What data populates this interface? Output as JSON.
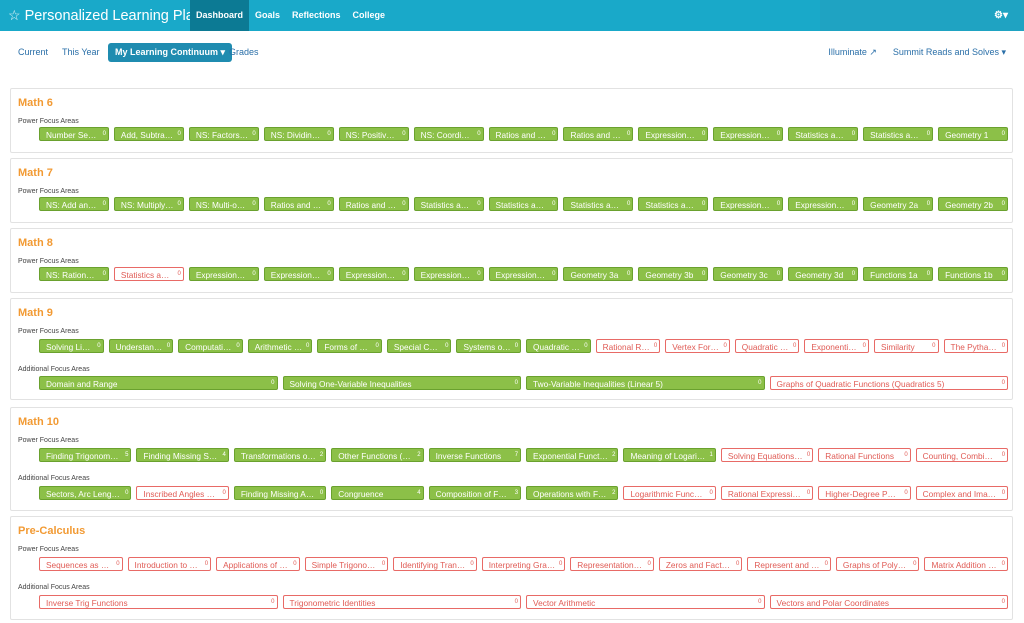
{
  "header": {
    "app_title": "Personalized Learning Plan",
    "nav": [
      "Dashboard",
      "Goals",
      "Reflections",
      "College"
    ],
    "user_icon": "⚙▾"
  },
  "subnav": {
    "tabs": [
      "Current",
      "This Year",
      "My Learning Continuum ▾",
      "Grades"
    ],
    "right_links": [
      "Illuminate ↗",
      "Summit Reads and Solves ▾"
    ]
  },
  "labels": {
    "power": "Power Focus Areas",
    "additional": "Additional Focus Areas"
  },
  "colors": {
    "header": "#19a9c9",
    "complete_green": "#8cc048",
    "incomplete_red": "#e05b55",
    "section_title": "#f29a33"
  },
  "sections": [
    {
      "title": "Math 6",
      "power": [
        {
          "t": "Number Sense",
          "c": "0",
          "s": "g"
        },
        {
          "t": "Add, Subtra…",
          "c": "0",
          "s": "g"
        },
        {
          "t": "NS: Factors …",
          "c": "0",
          "s": "g"
        },
        {
          "t": "NS: Dividing…",
          "c": "0",
          "s": "g"
        },
        {
          "t": "NS: Positive…",
          "c": "0",
          "s": "g"
        },
        {
          "t": "NS: Coordin…",
          "c": "0",
          "s": "g"
        },
        {
          "t": "Ratios and …",
          "c": "0",
          "s": "g"
        },
        {
          "t": "Ratios and …",
          "c": "0",
          "s": "g"
        },
        {
          "t": "Expressions…",
          "c": "0",
          "s": "g"
        },
        {
          "t": "Expressions…",
          "c": "0",
          "s": "g"
        },
        {
          "t": "Statistics an…",
          "c": "0",
          "s": "g"
        },
        {
          "t": "Statistics an…",
          "c": "0",
          "s": "g"
        },
        {
          "t": "Geometry 1",
          "c": "0",
          "s": "g"
        }
      ],
      "additional": []
    },
    {
      "title": "Math 7",
      "power": [
        {
          "t": "NS: Add an…",
          "c": "0",
          "s": "g"
        },
        {
          "t": "NS: Multiply…",
          "c": "0",
          "s": "g"
        },
        {
          "t": "NS: Multi-o…",
          "c": "0",
          "s": "g"
        },
        {
          "t": "Ratios and …",
          "c": "0",
          "s": "g"
        },
        {
          "t": "Ratios and …",
          "c": "0",
          "s": "g"
        },
        {
          "t": "Statistics an…",
          "c": "0",
          "s": "g"
        },
        {
          "t": "Statistics an…",
          "c": "0",
          "s": "g"
        },
        {
          "t": "Statistics an…",
          "c": "0",
          "s": "g"
        },
        {
          "t": "Statistics an…",
          "c": "0",
          "s": "g"
        },
        {
          "t": "Expressions…",
          "c": "0",
          "s": "g"
        },
        {
          "t": "Expressions…",
          "c": "0",
          "s": "g"
        },
        {
          "t": "Geometry 2a",
          "c": "0",
          "s": "g"
        },
        {
          "t": "Geometry 2b",
          "c": "0",
          "s": "g"
        }
      ],
      "additional": []
    },
    {
      "title": "Math 8",
      "power": [
        {
          "t": "NS: Rational…",
          "c": "0",
          "s": "g"
        },
        {
          "t": "Statistics an…",
          "c": "0",
          "s": "r"
        },
        {
          "t": "Expressions…",
          "c": "0",
          "s": "g"
        },
        {
          "t": "Expressions…",
          "c": "0",
          "s": "g"
        },
        {
          "t": "Expressions…",
          "c": "0",
          "s": "g"
        },
        {
          "t": "Expressions…",
          "c": "0",
          "s": "g"
        },
        {
          "t": "Expressions…",
          "c": "0",
          "s": "g"
        },
        {
          "t": "Geometry 3a",
          "c": "0",
          "s": "g"
        },
        {
          "t": "Geometry 3b",
          "c": "0",
          "s": "g"
        },
        {
          "t": "Geometry 3c",
          "c": "0",
          "s": "g"
        },
        {
          "t": "Geometry 3d",
          "c": "0",
          "s": "g"
        },
        {
          "t": "Functions 1a",
          "c": "0",
          "s": "g"
        },
        {
          "t": "Functions 1b",
          "c": "0",
          "s": "g"
        }
      ],
      "additional": []
    },
    {
      "title": "Math 9",
      "power": [
        {
          "t": "Solving Lin…",
          "c": "0",
          "s": "g"
        },
        {
          "t": "Understan…",
          "c": "0",
          "s": "g"
        },
        {
          "t": "Computati…",
          "c": "0",
          "s": "g"
        },
        {
          "t": "Arithmetic …",
          "c": "0",
          "s": "g"
        },
        {
          "t": "Forms of L…",
          "c": "0",
          "s": "g"
        },
        {
          "t": "Special Ca…",
          "c": "0",
          "s": "g"
        },
        {
          "t": "Systems of…",
          "c": "0",
          "s": "g"
        },
        {
          "t": "Quadratic …",
          "c": "0",
          "s": "g"
        },
        {
          "t": "Rational R…",
          "c": "0",
          "s": "r"
        },
        {
          "t": "Vertex For…",
          "c": "0",
          "s": "r"
        },
        {
          "t": "Quadratic …",
          "c": "0",
          "s": "r"
        },
        {
          "t": "Exponenti…",
          "c": "0",
          "s": "r"
        },
        {
          "t": "Similarity",
          "c": "0",
          "s": "r"
        },
        {
          "t": "The Pytha…",
          "c": "0",
          "s": "r"
        }
      ],
      "additional": [
        {
          "t": "Domain and Range",
          "c": "0",
          "s": "g"
        },
        {
          "t": "Solving One-Variable Inequalities",
          "c": "0",
          "s": "g"
        },
        {
          "t": "Two-Variable Inequalities (Linear 5)",
          "c": "0",
          "s": "g"
        },
        {
          "t": "Graphs of Quadratic Functions (Quadratics 5)",
          "c": "0",
          "s": "r"
        }
      ]
    },
    {
      "title": "Math 10",
      "power": [
        {
          "t": "Finding Trigonom…",
          "c": "5",
          "s": "g"
        },
        {
          "t": "Finding Missing Si…",
          "c": "4",
          "s": "g"
        },
        {
          "t": "Transformations o…",
          "c": "2",
          "s": "g"
        },
        {
          "t": "Other Functions (…",
          "c": "2",
          "s": "g"
        },
        {
          "t": "Inverse Functions",
          "c": "7",
          "s": "g"
        },
        {
          "t": "Exponential Funct…",
          "c": "2",
          "s": "g"
        },
        {
          "t": "Meaning of Logari…",
          "c": "1",
          "s": "g"
        },
        {
          "t": "Solving Equations…",
          "c": "0",
          "s": "r"
        },
        {
          "t": "Rational Functions",
          "c": "0",
          "s": "r"
        },
        {
          "t": "Counting, Combi…",
          "c": "0",
          "s": "r"
        }
      ],
      "additional": [
        {
          "t": "Sectors, Arc Leng…",
          "c": "0",
          "s": "g"
        },
        {
          "t": "Inscribed Angles …",
          "c": "0",
          "s": "r"
        },
        {
          "t": "Finding Missing A…",
          "c": "0",
          "s": "g"
        },
        {
          "t": "Congruence",
          "c": "4",
          "s": "g"
        },
        {
          "t": "Composition of F…",
          "c": "3",
          "s": "g"
        },
        {
          "t": "Operations with F…",
          "c": "2",
          "s": "g"
        },
        {
          "t": "Logarithmic Func…",
          "c": "0",
          "s": "r"
        },
        {
          "t": "Rational Expressi…",
          "c": "0",
          "s": "r"
        },
        {
          "t": "Higher-Degree P…",
          "c": "0",
          "s": "r"
        },
        {
          "t": "Complex and Ima…",
          "c": "0",
          "s": "r"
        }
      ]
    },
    {
      "title": "Pre-Calculus",
      "power": [
        {
          "t": "Sequences as …",
          "c": "0",
          "s": "r"
        },
        {
          "t": "Introduction to …",
          "c": "0",
          "s": "r"
        },
        {
          "t": "Applications of …",
          "c": "0",
          "s": "r"
        },
        {
          "t": "Simple Trigono…",
          "c": "0",
          "s": "r"
        },
        {
          "t": "Identifying Tran…",
          "c": "0",
          "s": "r"
        },
        {
          "t": "Interpreting Gra…",
          "c": "0",
          "s": "r"
        },
        {
          "t": "Representation …",
          "c": "0",
          "s": "r"
        },
        {
          "t": "Zeros and Fact…",
          "c": "0",
          "s": "r"
        },
        {
          "t": "Represent and …",
          "c": "0",
          "s": "r"
        },
        {
          "t": "Graphs of Poly…",
          "c": "0",
          "s": "r"
        },
        {
          "t": "Matrix Addition …",
          "c": "0",
          "s": "r"
        }
      ],
      "additional": [
        {
          "t": "Inverse Trig Functions",
          "c": "0",
          "s": "r"
        },
        {
          "t": "Trigonometric Identities",
          "c": "0",
          "s": "r"
        },
        {
          "t": "Vector Arithmetic",
          "c": "0",
          "s": "r"
        },
        {
          "t": "Vectors and Polar Coordinates",
          "c": "0",
          "s": "r"
        }
      ]
    }
  ]
}
